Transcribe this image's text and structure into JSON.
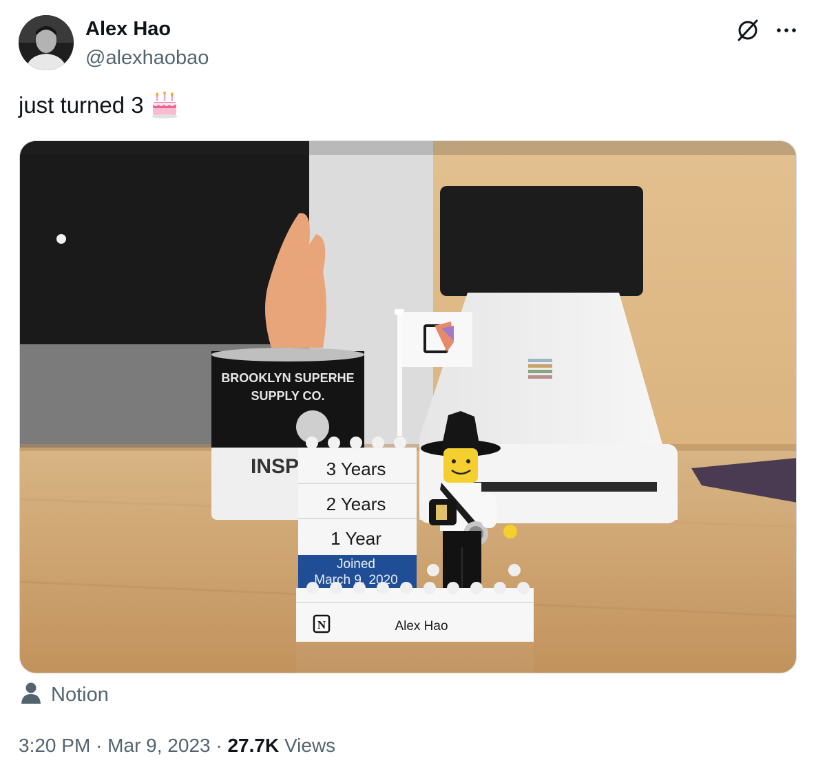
{
  "author": {
    "name": "Alex Hao",
    "handle": "@alexhaobao"
  },
  "tweet": {
    "text": "just turned 3",
    "emoji_icon": "birthday-cake-icon"
  },
  "media": {
    "lego": {
      "year3": "3 Years",
      "year2": "2 Years",
      "year1": "1 Year",
      "joined_line1": "Joined",
      "joined_line2": "March 9, 2020",
      "nameplate": "Alex Hao",
      "can_line1": "BROOKLYN SUPERHE",
      "can_line2": "SUPPLY CO.",
      "can_insp": "INSP"
    }
  },
  "tagged": {
    "label": "Notion",
    "icon": "person-icon"
  },
  "meta": {
    "time": "3:20 PM",
    "sep1": "·",
    "date": "Mar 9, 2023",
    "sep2": "·",
    "views_count": "27.7K",
    "views_label": "Views"
  },
  "colors": {
    "text_primary": "#0f1419",
    "text_secondary": "#536471",
    "joined_blue": "#1f4e96"
  }
}
